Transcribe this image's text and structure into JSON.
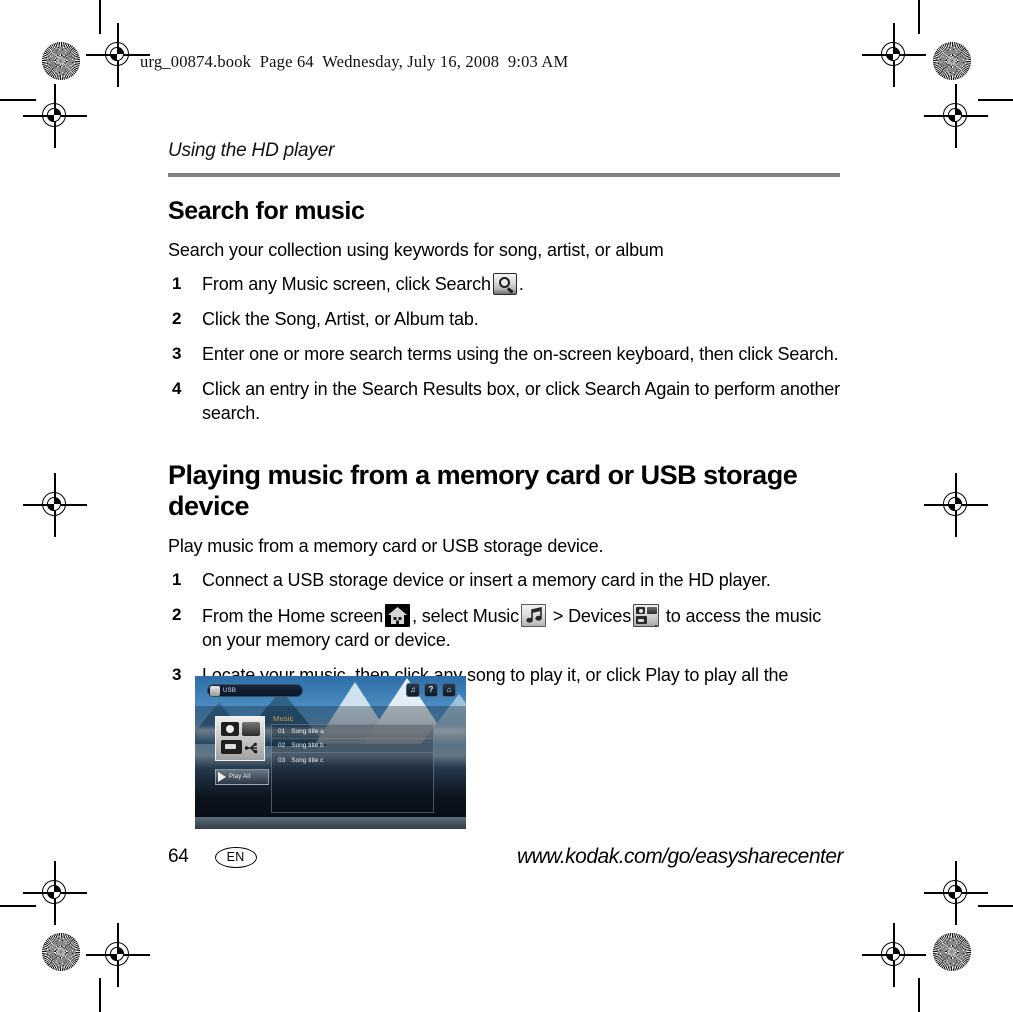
{
  "slug": "urg_00874.book  Page 64  Wednesday, July 16, 2008  9:03 AM",
  "running_head": "Using the HD player",
  "sections": [
    {
      "heading": "Search for music",
      "intro": "Search your collection using keywords for song, artist, or album",
      "steps": [
        {
          "num": "1",
          "text_before": "From any Music screen, click Search",
          "icon": "search-icon",
          "text_after": "."
        },
        {
          "num": "2",
          "text_before": "Click the Song, Artist, or Album tab.",
          "icon": "",
          "text_after": ""
        },
        {
          "num": "3",
          "text_before": "Enter one or more search terms using the on-screen keyboard, then click Search.",
          "icon": "",
          "text_after": ""
        },
        {
          "num": "4",
          "text_before": "Click an entry in the Search Results box, or click Search Again to perform another search.",
          "icon": "",
          "text_after": ""
        }
      ]
    },
    {
      "heading": "Playing music from a memory card or USB storage device",
      "intro": "Play music from a memory card or USB storage device.",
      "steps": [
        {
          "num": "1",
          "text": "Connect a USB storage device or insert a memory card in the HD player."
        },
        {
          "num": "2",
          "part1": "From the Home screen",
          "part2": ", select Music",
          "part3": "> Devices",
          "part4": "to access the music on your memory card or device."
        },
        {
          "num": "3",
          "text": "Locate your music, then click any song to play it, or click Play to play all the songs."
        }
      ]
    }
  ],
  "figure": {
    "titlebar_label": "USB",
    "titlebar_icon": "music-note-icon",
    "top_buttons": [
      {
        "name": "music-button",
        "glyph": "♫"
      },
      {
        "name": "help-button",
        "glyph": "?"
      },
      {
        "name": "home-button",
        "glyph": "⌂"
      }
    ],
    "thumbnail_name": "devices-thumbnail",
    "play_all_label": "Play All",
    "music_label": "Music",
    "songs": [
      {
        "num": "01",
        "title": "Song title a"
      },
      {
        "num": "02",
        "title": "Song title b"
      },
      {
        "num": "03",
        "title": "Song title c"
      }
    ]
  },
  "footer": {
    "page_number": "64",
    "language": "EN",
    "url": "www.kodak.com/go/easysharecenter"
  },
  "colors": {
    "rule": "#808080",
    "music_label": "#d9a441",
    "text": "#000000"
  }
}
